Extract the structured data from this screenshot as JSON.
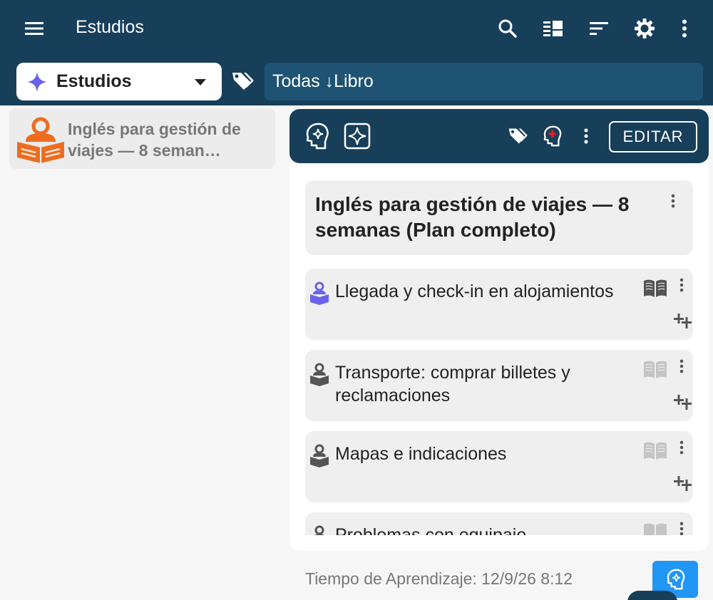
{
  "app": {
    "title": "Estudios"
  },
  "toolbar": {
    "icons": [
      "menu-icon",
      "search-icon",
      "card-browser-icon",
      "sort-icon",
      "gear-icon",
      "kebab-icon"
    ]
  },
  "filter": {
    "deck_name": "Estudios",
    "query": "Todas ↓Libro"
  },
  "deck_list": [
    {
      "name": "Inglés para gestión de viajes — 8 seman…",
      "icon": "study-person-icon"
    }
  ],
  "detail": {
    "edit_label": "EDITAR",
    "title": "Inglés para gestión de viajes — 8 semanas (Plan completo)",
    "items": [
      {
        "label": "Llegada y check-in en alojamientos",
        "active": true
      },
      {
        "label": "Transporte: comprar billetes y reclamaciones",
        "active": false
      },
      {
        "label": "Mapas e indicaciones",
        "active": false
      },
      {
        "label": "Problemas con equipaje",
        "active": false
      }
    ]
  },
  "footer": {
    "learning_time": "Tiempo de Aprendizaje:  12/9/26 8:12"
  },
  "colors": {
    "header": "#173f5a",
    "filter_field": "#1e5373",
    "accent_orange": "#ee6c1f",
    "accent_purple": "#6a63ea",
    "fab": "#2196f3"
  }
}
